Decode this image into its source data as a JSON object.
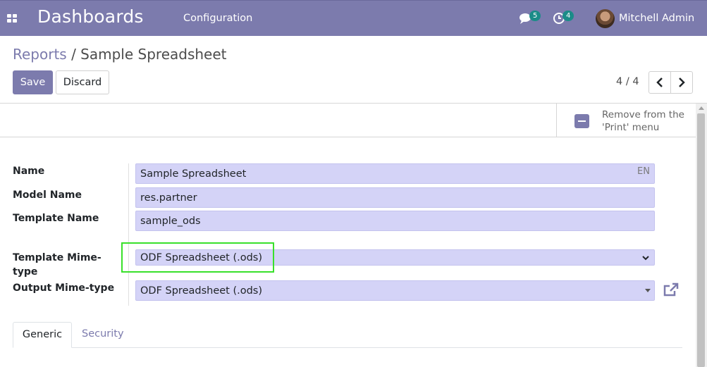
{
  "navbar": {
    "brand": "Dashboards",
    "menu": [
      "Configuration"
    ],
    "messages_count": "5",
    "activities_count": "4",
    "user_name": "Mitchell Admin"
  },
  "breadcrumb": {
    "parent": "Reports",
    "separator": " / ",
    "current": "Sample Spreadsheet"
  },
  "toolbar": {
    "save_label": "Save",
    "discard_label": "Discard"
  },
  "pager": {
    "value": "4 / 4"
  },
  "button_box": {
    "remove_print_line1": "Remove from the",
    "remove_print_line2": "'Print' menu"
  },
  "form": {
    "name_label": "Name",
    "name_value": "Sample Spreadsheet",
    "name_lang": "EN",
    "model_label": "Model Name",
    "model_value": "res.partner",
    "template_name_label": "Template Name",
    "template_name_value": "sample_ods",
    "template_mime_label_1": "Template Mime-",
    "template_mime_label_2": "type",
    "template_mime_value": "ODF Spreadsheet (.ods)",
    "output_mime_label": "Output Mime-type",
    "output_mime_value": "ODF Spreadsheet (.ods)"
  },
  "tabs": [
    "Generic",
    "Security"
  ],
  "colors": {
    "brand": "#7c7bad",
    "field_bg": "#d4d3f7",
    "highlight": "#39e02b",
    "badge": "#1b8c88"
  }
}
